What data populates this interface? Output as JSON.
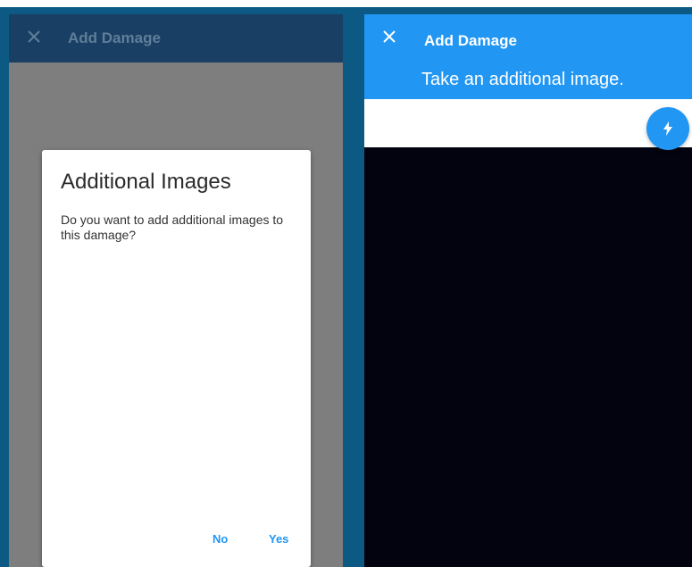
{
  "left_panel": {
    "app_bar": {
      "title": "Add Damage",
      "close_icon": "close-icon"
    },
    "dialog": {
      "title": "Additional Images",
      "message": "Do you want to add additional images to this damage?",
      "buttons": {
        "no": "No",
        "yes": "Yes"
      }
    }
  },
  "right_panel": {
    "app_bar": {
      "title": "Add Damage",
      "close_icon": "close-icon"
    },
    "subtitle": "Take an additional image.",
    "flash_button": {
      "icon": "flash-icon"
    }
  },
  "colors": {
    "accent": "#2196f3",
    "frame": "#0c5a84",
    "dim_appbar": "#1a3f64",
    "camera_background": "#03030f"
  }
}
